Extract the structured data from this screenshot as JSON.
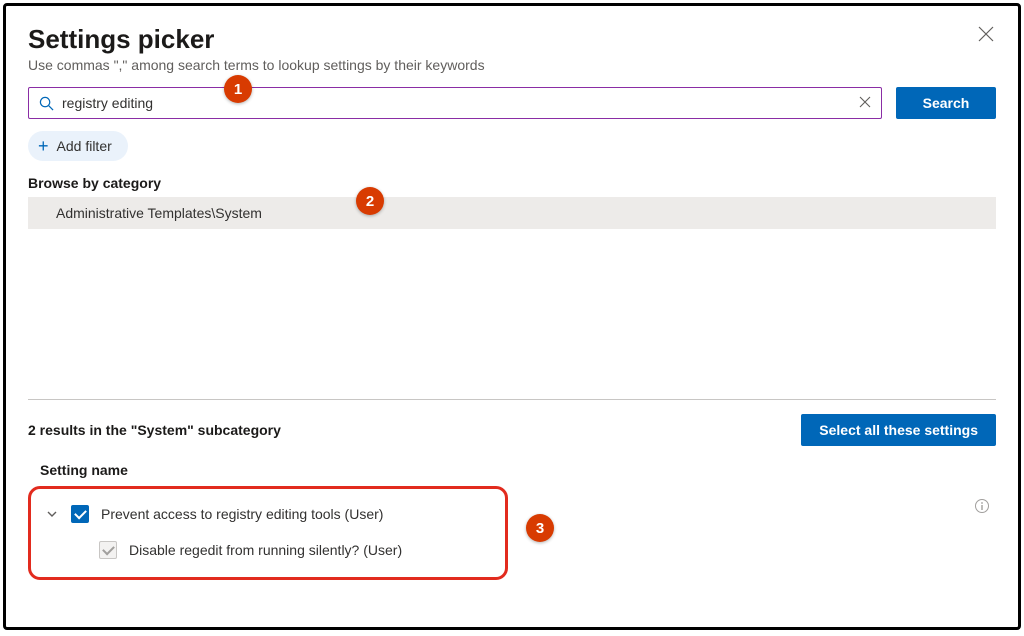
{
  "header": {
    "title": "Settings picker",
    "subtitle": "Use commas \",\" among search terms to lookup settings by their keywords"
  },
  "search": {
    "value": "registry editing",
    "button_label": "Search"
  },
  "filter": {
    "add_label": "Add filter"
  },
  "browse": {
    "label": "Browse by category",
    "category": "Administrative Templates\\System"
  },
  "results": {
    "summary": "2 results in the \"System\" subcategory",
    "select_all_label": "Select all these settings",
    "column_header": "Setting name",
    "items": [
      {
        "label": "Prevent access to registry editing tools (User)",
        "checked": true
      },
      {
        "label": "Disable regedit from running silently? (User)",
        "checked_disabled": true
      }
    ]
  },
  "annotations": {
    "b1": "1",
    "b2": "2",
    "b3": "3"
  }
}
